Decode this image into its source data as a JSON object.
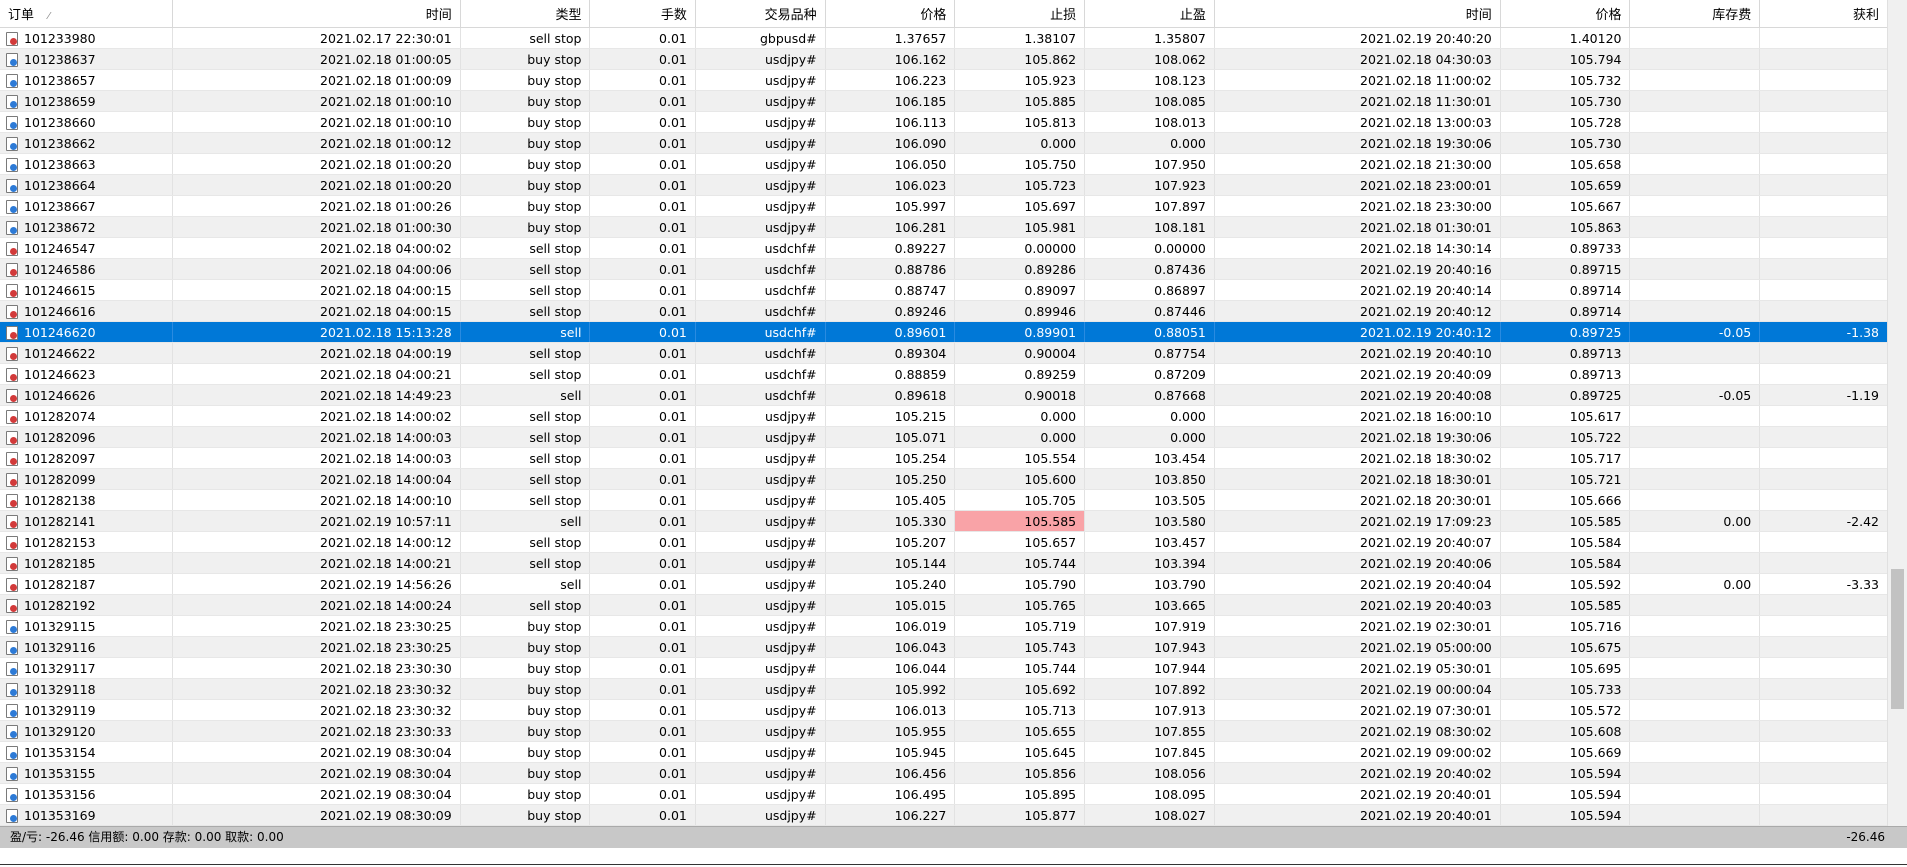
{
  "columns": [
    "订单",
    "时间",
    "类型",
    "手数",
    "交易品种",
    "价格",
    "止损",
    "止盈",
    "时间",
    "价格",
    "库存费",
    "获利"
  ],
  "sort_indicator": "⁄",
  "rows": [
    {
      "order": "101233980",
      "open_time": "2021.02.17 22:30:01",
      "type": "sell stop",
      "lots": "0.01",
      "symbol": "gbpusd#",
      "price": "1.37657",
      "sl": "1.38107",
      "tp": "1.35807",
      "close_time": "2021.02.19 20:40:20",
      "close_price": "1.40120",
      "swap": "",
      "profit": "",
      "icon": "red"
    },
    {
      "order": "101238637",
      "open_time": "2021.02.18 01:00:05",
      "type": "buy stop",
      "lots": "0.01",
      "symbol": "usdjpy#",
      "price": "106.162",
      "sl": "105.862",
      "tp": "108.062",
      "close_time": "2021.02.18 04:30:03",
      "close_price": "105.794",
      "swap": "",
      "profit": "",
      "icon": "blue"
    },
    {
      "order": "101238657",
      "open_time": "2021.02.18 01:00:09",
      "type": "buy stop",
      "lots": "0.01",
      "symbol": "usdjpy#",
      "price": "106.223",
      "sl": "105.923",
      "tp": "108.123",
      "close_time": "2021.02.18 11:00:02",
      "close_price": "105.732",
      "swap": "",
      "profit": "",
      "icon": "blue"
    },
    {
      "order": "101238659",
      "open_time": "2021.02.18 01:00:10",
      "type": "buy stop",
      "lots": "0.01",
      "symbol": "usdjpy#",
      "price": "106.185",
      "sl": "105.885",
      "tp": "108.085",
      "close_time": "2021.02.18 11:30:01",
      "close_price": "105.730",
      "swap": "",
      "profit": "",
      "icon": "blue"
    },
    {
      "order": "101238660",
      "open_time": "2021.02.18 01:00:10",
      "type": "buy stop",
      "lots": "0.01",
      "symbol": "usdjpy#",
      "price": "106.113",
      "sl": "105.813",
      "tp": "108.013",
      "close_time": "2021.02.18 13:00:03",
      "close_price": "105.728",
      "swap": "",
      "profit": "",
      "icon": "blue"
    },
    {
      "order": "101238662",
      "open_time": "2021.02.18 01:00:12",
      "type": "buy stop",
      "lots": "0.01",
      "symbol": "usdjpy#",
      "price": "106.090",
      "sl": "0.000",
      "tp": "0.000",
      "close_time": "2021.02.18 19:30:06",
      "close_price": "105.730",
      "swap": "",
      "profit": "",
      "icon": "blue"
    },
    {
      "order": "101238663",
      "open_time": "2021.02.18 01:00:20",
      "type": "buy stop",
      "lots": "0.01",
      "symbol": "usdjpy#",
      "price": "106.050",
      "sl": "105.750",
      "tp": "107.950",
      "close_time": "2021.02.18 21:30:00",
      "close_price": "105.658",
      "swap": "",
      "profit": "",
      "icon": "blue"
    },
    {
      "order": "101238664",
      "open_time": "2021.02.18 01:00:20",
      "type": "buy stop",
      "lots": "0.01",
      "symbol": "usdjpy#",
      "price": "106.023",
      "sl": "105.723",
      "tp": "107.923",
      "close_time": "2021.02.18 23:00:01",
      "close_price": "105.659",
      "swap": "",
      "profit": "",
      "icon": "blue"
    },
    {
      "order": "101238667",
      "open_time": "2021.02.18 01:00:26",
      "type": "buy stop",
      "lots": "0.01",
      "symbol": "usdjpy#",
      "price": "105.997",
      "sl": "105.697",
      "tp": "107.897",
      "close_time": "2021.02.18 23:30:00",
      "close_price": "105.667",
      "swap": "",
      "profit": "",
      "icon": "blue"
    },
    {
      "order": "101238672",
      "open_time": "2021.02.18 01:00:30",
      "type": "buy stop",
      "lots": "0.01",
      "symbol": "usdjpy#",
      "price": "106.281",
      "sl": "105.981",
      "tp": "108.181",
      "close_time": "2021.02.18 01:30:01",
      "close_price": "105.863",
      "swap": "",
      "profit": "",
      "icon": "blue"
    },
    {
      "order": "101246547",
      "open_time": "2021.02.18 04:00:02",
      "type": "sell stop",
      "lots": "0.01",
      "symbol": "usdchf#",
      "price": "0.89227",
      "sl": "0.00000",
      "tp": "0.00000",
      "close_time": "2021.02.18 14:30:14",
      "close_price": "0.89733",
      "swap": "",
      "profit": "",
      "icon": "red"
    },
    {
      "order": "101246586",
      "open_time": "2021.02.18 04:00:06",
      "type": "sell stop",
      "lots": "0.01",
      "symbol": "usdchf#",
      "price": "0.88786",
      "sl": "0.89286",
      "tp": "0.87436",
      "close_time": "2021.02.19 20:40:16",
      "close_price": "0.89715",
      "swap": "",
      "profit": "",
      "icon": "red"
    },
    {
      "order": "101246615",
      "open_time": "2021.02.18 04:00:15",
      "type": "sell stop",
      "lots": "0.01",
      "symbol": "usdchf#",
      "price": "0.88747",
      "sl": "0.89097",
      "tp": "0.86897",
      "close_time": "2021.02.19 20:40:14",
      "close_price": "0.89714",
      "swap": "",
      "profit": "",
      "icon": "red"
    },
    {
      "order": "101246616",
      "open_time": "2021.02.18 04:00:15",
      "type": "sell stop",
      "lots": "0.01",
      "symbol": "usdchf#",
      "price": "0.89246",
      "sl": "0.89946",
      "tp": "0.87446",
      "close_time": "2021.02.19 20:40:12",
      "close_price": "0.89714",
      "swap": "",
      "profit": "",
      "icon": "red"
    },
    {
      "order": "101246620",
      "open_time": "2021.02.18 15:13:28",
      "type": "sell",
      "lots": "0.01",
      "symbol": "usdchf#",
      "price": "0.89601",
      "sl": "0.89901",
      "tp": "0.88051",
      "close_time": "2021.02.19 20:40:12",
      "close_price": "0.89725",
      "swap": "-0.05",
      "profit": "-1.38",
      "icon": "red",
      "selected": true
    },
    {
      "order": "101246622",
      "open_time": "2021.02.18 04:00:19",
      "type": "sell stop",
      "lots": "0.01",
      "symbol": "usdchf#",
      "price": "0.89304",
      "sl": "0.90004",
      "tp": "0.87754",
      "close_time": "2021.02.19 20:40:10",
      "close_price": "0.89713",
      "swap": "",
      "profit": "",
      "icon": "red"
    },
    {
      "order": "101246623",
      "open_time": "2021.02.18 04:00:21",
      "type": "sell stop",
      "lots": "0.01",
      "symbol": "usdchf#",
      "price": "0.88859",
      "sl": "0.89259",
      "tp": "0.87209",
      "close_time": "2021.02.19 20:40:09",
      "close_price": "0.89713",
      "swap": "",
      "profit": "",
      "icon": "red"
    },
    {
      "order": "101246626",
      "open_time": "2021.02.18 14:49:23",
      "type": "sell",
      "lots": "0.01",
      "symbol": "usdchf#",
      "price": "0.89618",
      "sl": "0.90018",
      "tp": "0.87668",
      "close_time": "2021.02.19 20:40:08",
      "close_price": "0.89725",
      "swap": "-0.05",
      "profit": "-1.19",
      "icon": "red"
    },
    {
      "order": "101282074",
      "open_time": "2021.02.18 14:00:02",
      "type": "sell stop",
      "lots": "0.01",
      "symbol": "usdjpy#",
      "price": "105.215",
      "sl": "0.000",
      "tp": "0.000",
      "close_time": "2021.02.18 16:00:10",
      "close_price": "105.617",
      "swap": "",
      "profit": "",
      "icon": "red"
    },
    {
      "order": "101282096",
      "open_time": "2021.02.18 14:00:03",
      "type": "sell stop",
      "lots": "0.01",
      "symbol": "usdjpy#",
      "price": "105.071",
      "sl": "0.000",
      "tp": "0.000",
      "close_time": "2021.02.18 19:30:06",
      "close_price": "105.722",
      "swap": "",
      "profit": "",
      "icon": "red"
    },
    {
      "order": "101282097",
      "open_time": "2021.02.18 14:00:03",
      "type": "sell stop",
      "lots": "0.01",
      "symbol": "usdjpy#",
      "price": "105.254",
      "sl": "105.554",
      "tp": "103.454",
      "close_time": "2021.02.18 18:30:02",
      "close_price": "105.717",
      "swap": "",
      "profit": "",
      "icon": "red"
    },
    {
      "order": "101282099",
      "open_time": "2021.02.18 14:00:04",
      "type": "sell stop",
      "lots": "0.01",
      "symbol": "usdjpy#",
      "price": "105.250",
      "sl": "105.600",
      "tp": "103.850",
      "close_time": "2021.02.18 18:30:01",
      "close_price": "105.721",
      "swap": "",
      "profit": "",
      "icon": "red"
    },
    {
      "order": "101282138",
      "open_time": "2021.02.18 14:00:10",
      "type": "sell stop",
      "lots": "0.01",
      "symbol": "usdjpy#",
      "price": "105.405",
      "sl": "105.705",
      "tp": "103.505",
      "close_time": "2021.02.18 20:30:01",
      "close_price": "105.666",
      "swap": "",
      "profit": "",
      "icon": "red"
    },
    {
      "order": "101282141",
      "open_time": "2021.02.19 10:57:11",
      "type": "sell",
      "lots": "0.01",
      "symbol": "usdjpy#",
      "price": "105.330",
      "sl": "105.585",
      "tp": "103.580",
      "close_time": "2021.02.19 17:09:23",
      "close_price": "105.585",
      "swap": "0.00",
      "profit": "-2.42",
      "icon": "red",
      "sl_alert": true
    },
    {
      "order": "101282153",
      "open_time": "2021.02.18 14:00:12",
      "type": "sell stop",
      "lots": "0.01",
      "symbol": "usdjpy#",
      "price": "105.207",
      "sl": "105.657",
      "tp": "103.457",
      "close_time": "2021.02.19 20:40:07",
      "close_price": "105.584",
      "swap": "",
      "profit": "",
      "icon": "red"
    },
    {
      "order": "101282185",
      "open_time": "2021.02.18 14:00:21",
      "type": "sell stop",
      "lots": "0.01",
      "symbol": "usdjpy#",
      "price": "105.144",
      "sl": "105.744",
      "tp": "103.394",
      "close_time": "2021.02.19 20:40:06",
      "close_price": "105.584",
      "swap": "",
      "profit": "",
      "icon": "red"
    },
    {
      "order": "101282187",
      "open_time": "2021.02.19 14:56:26",
      "type": "sell",
      "lots": "0.01",
      "symbol": "usdjpy#",
      "price": "105.240",
      "sl": "105.790",
      "tp": "103.790",
      "close_time": "2021.02.19 20:40:04",
      "close_price": "105.592",
      "swap": "0.00",
      "profit": "-3.33",
      "icon": "red"
    },
    {
      "order": "101282192",
      "open_time": "2021.02.18 14:00:24",
      "type": "sell stop",
      "lots": "0.01",
      "symbol": "usdjpy#",
      "price": "105.015",
      "sl": "105.765",
      "tp": "103.665",
      "close_time": "2021.02.19 20:40:03",
      "close_price": "105.585",
      "swap": "",
      "profit": "",
      "icon": "red"
    },
    {
      "order": "101329115",
      "open_time": "2021.02.18 23:30:25",
      "type": "buy stop",
      "lots": "0.01",
      "symbol": "usdjpy#",
      "price": "106.019",
      "sl": "105.719",
      "tp": "107.919",
      "close_time": "2021.02.19 02:30:01",
      "close_price": "105.716",
      "swap": "",
      "profit": "",
      "icon": "blue"
    },
    {
      "order": "101329116",
      "open_time": "2021.02.18 23:30:25",
      "type": "buy stop",
      "lots": "0.01",
      "symbol": "usdjpy#",
      "price": "106.043",
      "sl": "105.743",
      "tp": "107.943",
      "close_time": "2021.02.19 05:00:00",
      "close_price": "105.675",
      "swap": "",
      "profit": "",
      "icon": "blue"
    },
    {
      "order": "101329117",
      "open_time": "2021.02.18 23:30:30",
      "type": "buy stop",
      "lots": "0.01",
      "symbol": "usdjpy#",
      "price": "106.044",
      "sl": "105.744",
      "tp": "107.944",
      "close_time": "2021.02.19 05:30:01",
      "close_price": "105.695",
      "swap": "",
      "profit": "",
      "icon": "blue"
    },
    {
      "order": "101329118",
      "open_time": "2021.02.18 23:30:32",
      "type": "buy stop",
      "lots": "0.01",
      "symbol": "usdjpy#",
      "price": "105.992",
      "sl": "105.692",
      "tp": "107.892",
      "close_time": "2021.02.19 00:00:04",
      "close_price": "105.733",
      "swap": "",
      "profit": "",
      "icon": "blue"
    },
    {
      "order": "101329119",
      "open_time": "2021.02.18 23:30:32",
      "type": "buy stop",
      "lots": "0.01",
      "symbol": "usdjpy#",
      "price": "106.013",
      "sl": "105.713",
      "tp": "107.913",
      "close_time": "2021.02.19 07:30:01",
      "close_price": "105.572",
      "swap": "",
      "profit": "",
      "icon": "blue"
    },
    {
      "order": "101329120",
      "open_time": "2021.02.18 23:30:33",
      "type": "buy stop",
      "lots": "0.01",
      "symbol": "usdjpy#",
      "price": "105.955",
      "sl": "105.655",
      "tp": "107.855",
      "close_time": "2021.02.19 08:30:02",
      "close_price": "105.608",
      "swap": "",
      "profit": "",
      "icon": "blue"
    },
    {
      "order": "101353154",
      "open_time": "2021.02.19 08:30:04",
      "type": "buy stop",
      "lots": "0.01",
      "symbol": "usdjpy#",
      "price": "105.945",
      "sl": "105.645",
      "tp": "107.845",
      "close_time": "2021.02.19 09:00:02",
      "close_price": "105.669",
      "swap": "",
      "profit": "",
      "icon": "blue"
    },
    {
      "order": "101353155",
      "open_time": "2021.02.19 08:30:04",
      "type": "buy stop",
      "lots": "0.01",
      "symbol": "usdjpy#",
      "price": "106.456",
      "sl": "105.856",
      "tp": "108.056",
      "close_time": "2021.02.19 20:40:02",
      "close_price": "105.594",
      "swap": "",
      "profit": "",
      "icon": "blue"
    },
    {
      "order": "101353156",
      "open_time": "2021.02.19 08:30:04",
      "type": "buy stop",
      "lots": "0.01",
      "symbol": "usdjpy#",
      "price": "106.495",
      "sl": "105.895",
      "tp": "108.095",
      "close_time": "2021.02.19 20:40:01",
      "close_price": "105.594",
      "swap": "",
      "profit": "",
      "icon": "blue"
    },
    {
      "order": "101353169",
      "open_time": "2021.02.19 08:30:09",
      "type": "buy stop",
      "lots": "0.01",
      "symbol": "usdjpy#",
      "price": "106.227",
      "sl": "105.877",
      "tp": "108.027",
      "close_time": "2021.02.19 20:40:01",
      "close_price": "105.594",
      "swap": "",
      "profit": "",
      "icon": "blue"
    }
  ],
  "summary": {
    "text": "盈/亏: -26.46  信用额: 0.00  存款: 0.00  取款: 0.00",
    "total": "-26.46"
  },
  "scroll_position": 0.83
}
